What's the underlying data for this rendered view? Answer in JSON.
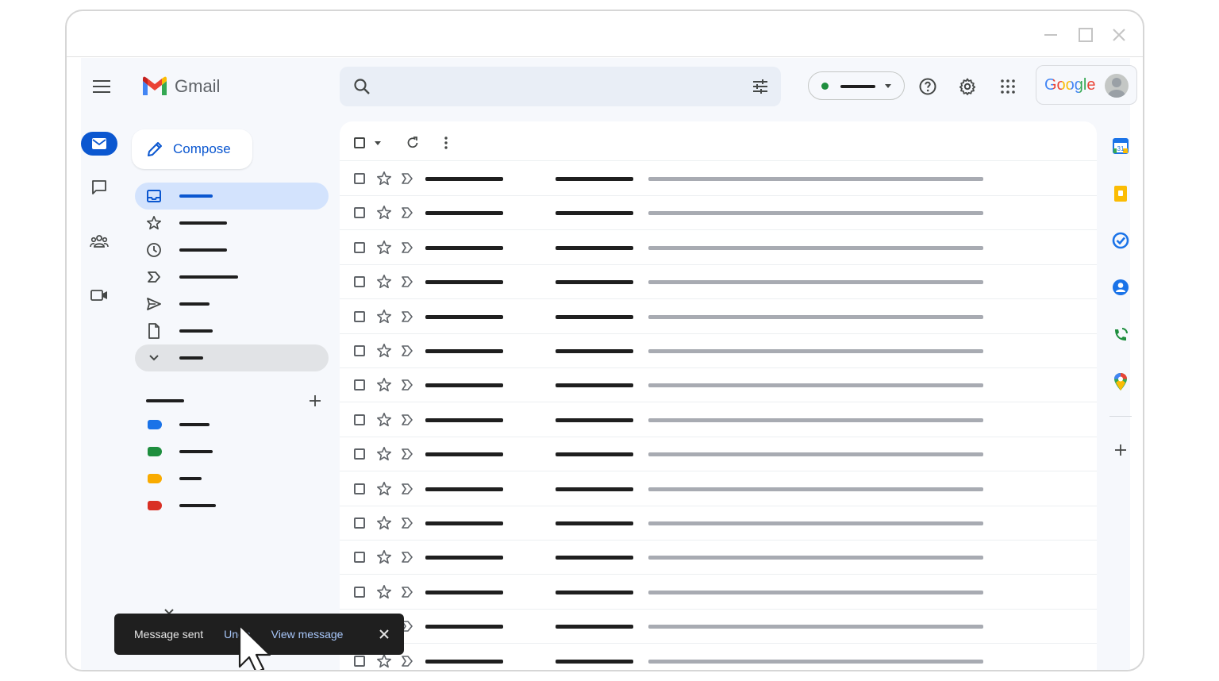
{
  "app": {
    "name": "Gmail",
    "account_brand": "Google"
  },
  "compose": {
    "label": "Compose"
  },
  "nav": {
    "items": [
      {
        "icon": "inbox-icon",
        "active": true
      },
      {
        "icon": "star-icon"
      },
      {
        "icon": "clock-icon"
      },
      {
        "icon": "label-important-icon"
      },
      {
        "icon": "send-icon"
      },
      {
        "icon": "draft-file-icon"
      },
      {
        "icon": "chevron-down-icon",
        "more": true
      }
    ]
  },
  "labels": {
    "colors": [
      "#1a73e8",
      "#1e8e3e",
      "#f9ab00",
      "#d93025"
    ]
  },
  "side_apps": [
    "calendar-icon",
    "keep-icon",
    "tasks-icon",
    "contacts-icon",
    "voice-icon",
    "maps-icon",
    "add-icon"
  ],
  "status": {
    "dot_color": "#1e8e3e"
  },
  "snackbar": {
    "message": "Message sent",
    "undo_label": "Undo",
    "view_label": "View message"
  },
  "colors": {
    "accent": "#0b57d0",
    "active_nav": "#d3e3fd",
    "snackbar_bg": "#1f1f1f",
    "link": "#a8c7fa"
  }
}
